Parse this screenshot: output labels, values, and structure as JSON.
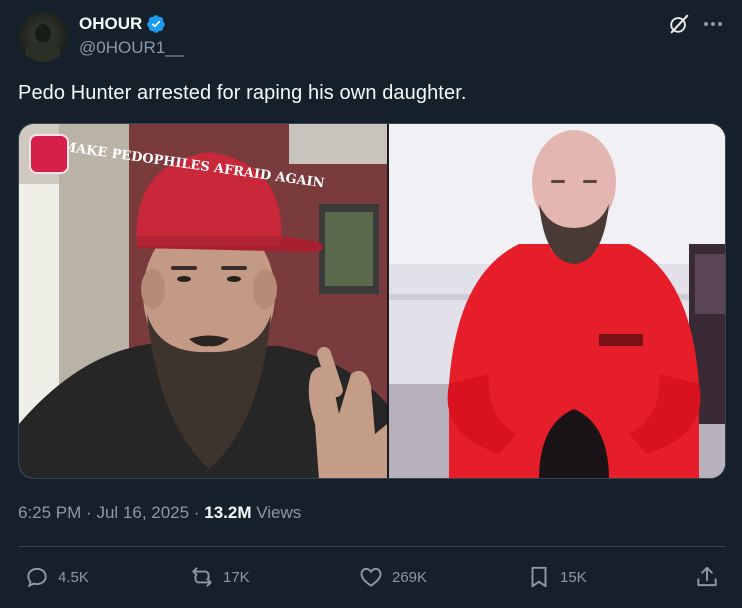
{
  "author": {
    "display_name": "OHOUR",
    "handle": "@0HOUR1__",
    "verified": true
  },
  "header_icons": [
    "grok-icon",
    "more-icon"
  ],
  "tweet": {
    "text": "Pedo Hunter arrested for raping his own daughter.",
    "media_cap_text": "MAKE PEDOPHILES AFRAID AGAIN"
  },
  "meta": {
    "time": "6:25 PM",
    "date": "Jul 16, 2025",
    "separator": "·",
    "views_count": "13.2M",
    "views_label": "Views"
  },
  "actions": {
    "replies": "4.5K",
    "reposts": "17K",
    "likes": "269K",
    "bookmarks": "15K"
  },
  "colors": {
    "background": "#15202b",
    "text_primary": "#f7f9f9",
    "text_secondary": "#8b98a5",
    "border": "#38444d",
    "verified_blue": "#1d9bf0"
  }
}
